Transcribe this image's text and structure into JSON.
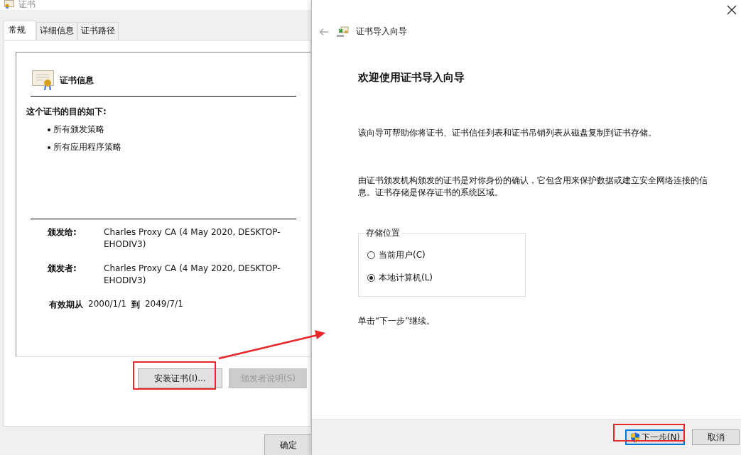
{
  "cert_window": {
    "title": "证书",
    "tabs": [
      {
        "label": "常规",
        "selected": true
      },
      {
        "label": "详细信息",
        "selected": false
      },
      {
        "label": "证书路径",
        "selected": false
      }
    ],
    "heading": "证书信息",
    "purpose_title": "这个证书的目的如下:",
    "purposes": [
      "所有颁发策略",
      "所有应用程序策略"
    ],
    "fields": [
      {
        "label": "颁发给:",
        "value": "Charles Proxy CA (4 May 2020, DESKTOP-EHODIV3)"
      },
      {
        "label": "颁发者:",
        "value": "Charles Proxy CA (4 May 2020, DESKTOP-EHODIV3)"
      }
    ],
    "validity": {
      "label": "有效期从",
      "from": "2000/1/1",
      "to_label": "到",
      "to": "2049/7/1"
    },
    "buttons": [
      {
        "label": "安装证书(I)...",
        "disabled": false
      },
      {
        "label": "颁发者说明(S)",
        "disabled": true
      }
    ],
    "ok_button": "确定"
  },
  "wizard": {
    "title": "证书导入向导",
    "heading": "欢迎使用证书导入向导",
    "paragraphs": [
      "该向导可帮助你将证书、证书信任列表和证书吊销列表从磁盘复制到证书存储。",
      "由证书颁发机构颁发的证书是对你身份的确认，它包含用来保护数据或建立安全网络连接的信息。证书存储是保存证书的系统区域。"
    ],
    "store_location": {
      "legend": "存储位置",
      "options": [
        {
          "label": "当前用户(C)",
          "selected": false
        },
        {
          "label": "本地计算机(L)",
          "selected": true
        }
      ]
    },
    "continue_text": "单击“下一步”继续。",
    "buttons": [
      {
        "label": "下一步(N)",
        "default": true
      },
      {
        "label": "取消",
        "default": false
      }
    ]
  }
}
